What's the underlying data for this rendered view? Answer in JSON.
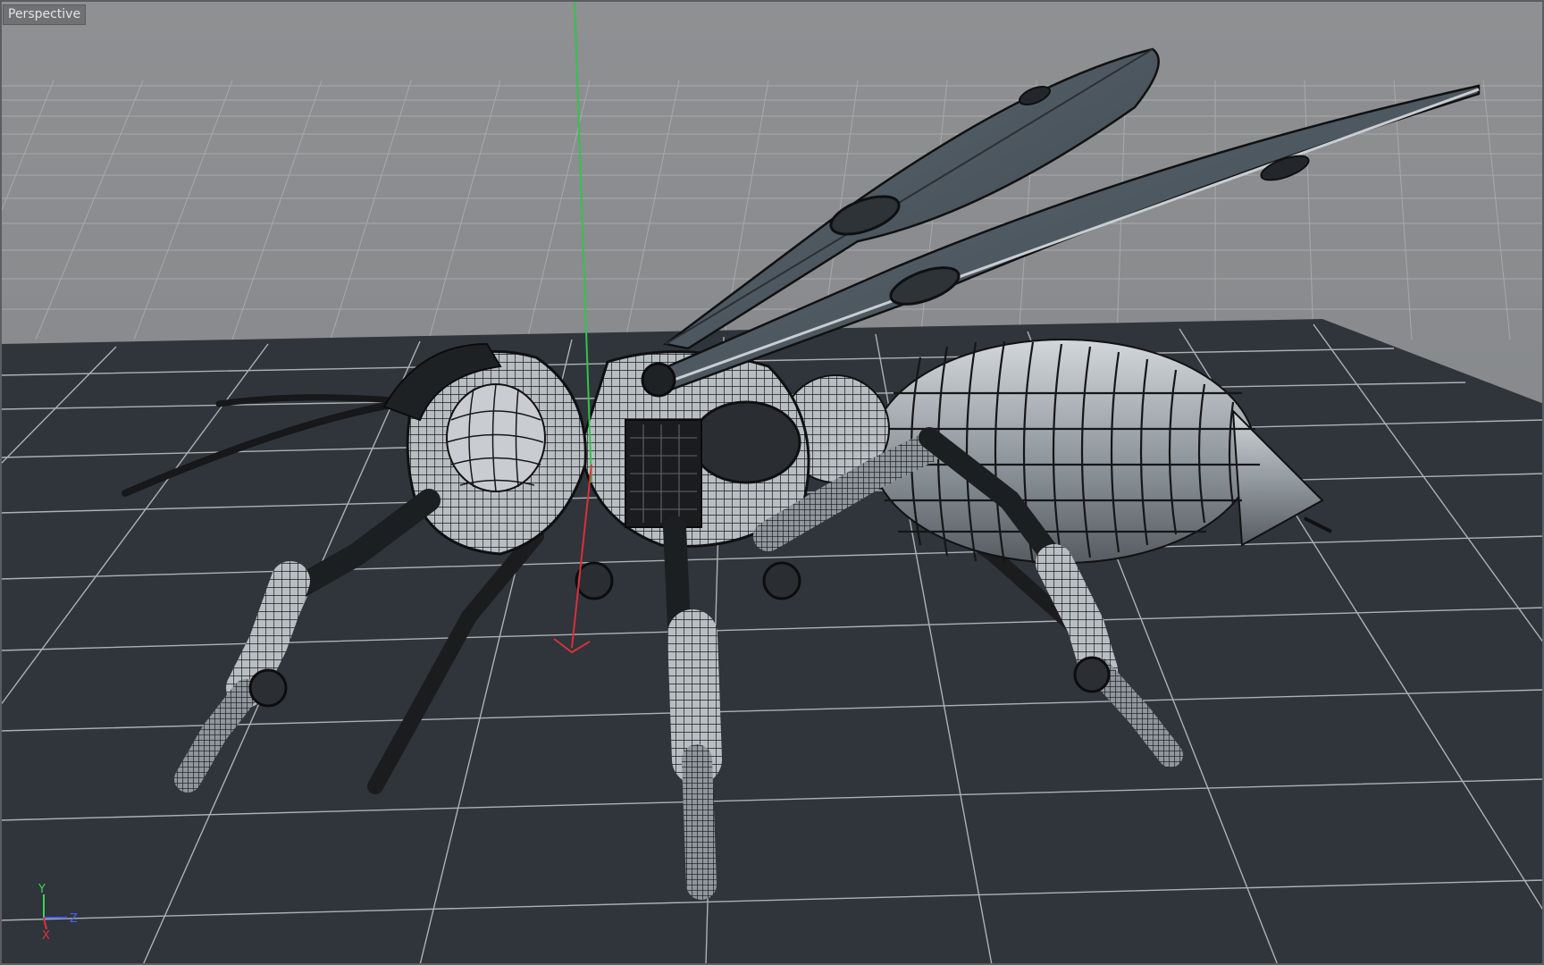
{
  "viewport": {
    "label": "Perspective",
    "background": "#8c8e90",
    "floor_color": "#2f353b",
    "grid_color": "#c5c7c9"
  },
  "axis_gizmo": {
    "y_label": "Y",
    "z_label": "Z",
    "x_label": "X",
    "y_color": "#3fd35a",
    "z_color": "#4a5cff",
    "x_color": "#e0303a"
  },
  "model": {
    "icon": "wasp-wireframe-model"
  }
}
